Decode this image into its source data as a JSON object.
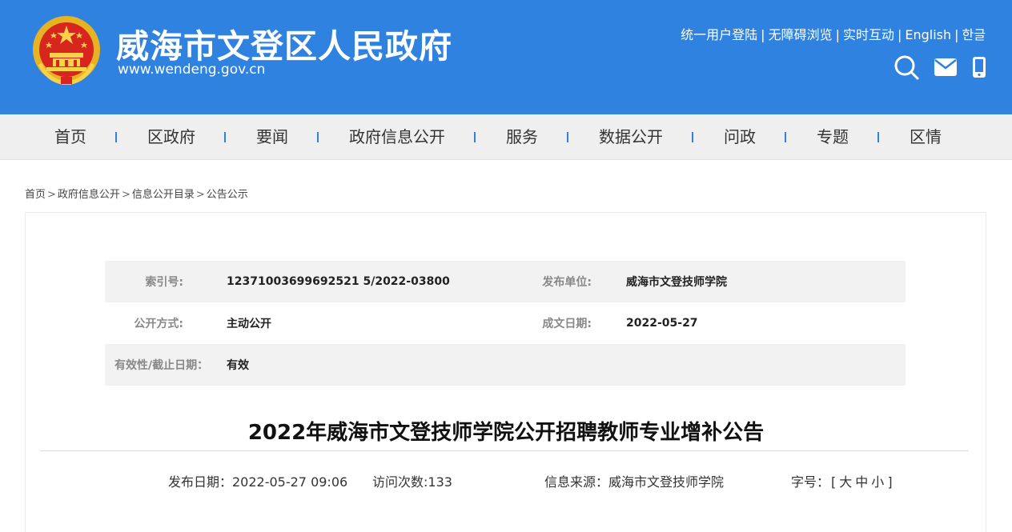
{
  "header": {
    "site_title": "威海市文登区人民政府",
    "site_url": "www.wendeng.gov.cn",
    "top_links": [
      "统一用户登陆",
      "无障碍浏览",
      "实时互动",
      "English",
      "한글"
    ],
    "separator": "|",
    "icons": [
      "search-icon",
      "mail-icon",
      "mobile-icon"
    ]
  },
  "nav": {
    "items": [
      "首页",
      "区政府",
      "要闻",
      "政府信息公开",
      "服务",
      "数据公开",
      "问政",
      "专题",
      "区情"
    ]
  },
  "breadcrumb": {
    "items": [
      "首页",
      "政府信息公开",
      "信息公开目录",
      "公告公示"
    ],
    "separator": ">"
  },
  "meta": {
    "index_label": "索引号:",
    "index_value": "12371003699692521 5/2022-03800",
    "publisher_label": "发布单位:",
    "publisher_value": "威海市文登技师学院",
    "method_label": "公开方式:",
    "method_value": "主动公开",
    "date_label": "成文日期:",
    "date_value": "2022-05-27",
    "validity_label": "有效性/截止日期：",
    "validity_value": "有效"
  },
  "article": {
    "title": "2022年威海市文登技师学院公开招聘教师专业增补公告",
    "publish_date": "发布日期：2022-05-27 09:06",
    "visits": "访问次数:133",
    "source": "信息来源：威海市文登技师学院",
    "font_label": "字号：",
    "font_open": "[",
    "font_large": "大",
    "font_medium": "中",
    "font_small": "小",
    "font_close": "]"
  },
  "colors": {
    "header_bg": "#2f82df",
    "nav_bg": "#efefef",
    "nav_divider": "#2f82df",
    "shaded_row": "#f2f2f2"
  }
}
